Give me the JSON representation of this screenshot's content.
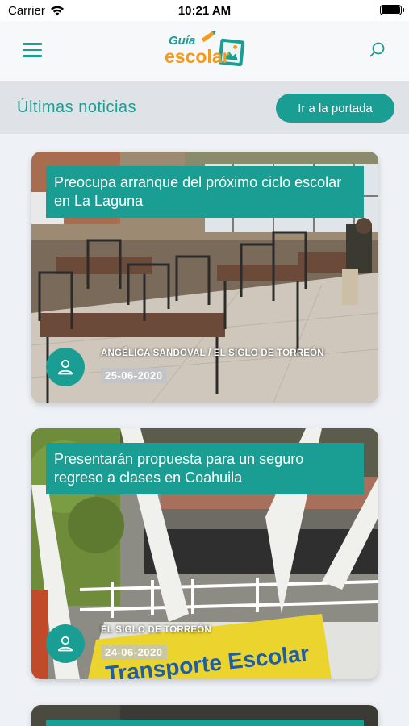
{
  "status_bar": {
    "carrier": "Carrier",
    "time": "10:21 AM"
  },
  "header": {
    "logo_top": "Guía",
    "logo_bottom": "escolar",
    "menu_icon": "hamburger-menu-icon",
    "search_icon": "search-icon"
  },
  "section": {
    "title": "Últimas noticias",
    "button_label": "Ir a la portada"
  },
  "news": [
    {
      "title": "Preocupa arranque del próximo ciclo escolar en La Laguna",
      "author": "ANGÉLICA SANDOVAL / EL SIGLO DE TORREÓN",
      "date": "25-06-2020"
    },
    {
      "title": "Presentarán propuesta para un seguro regreso a clases en Coahuila",
      "author": "EL SIGLO DE TORREÓN",
      "date": "24-06-2020",
      "image_sign_text": "Transporte Escolar"
    },
    {
      "title": ""
    }
  ],
  "colors": {
    "accent": "#1a9e93",
    "logo_orange": "#f59a1b",
    "background": "#eef1f5"
  }
}
